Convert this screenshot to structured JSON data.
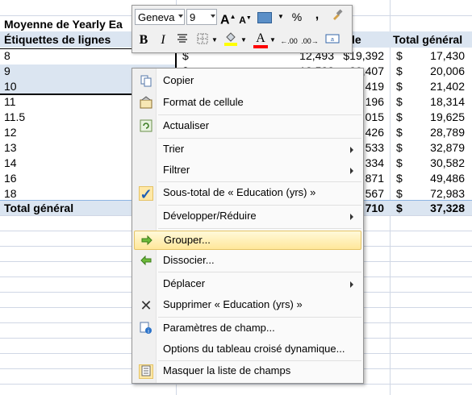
{
  "sheet": {
    "header_title": "Moyenne de Yearly Ea",
    "row_labels_header": "Étiquettes de lignes",
    "col_header_partial": "le",
    "total_header": "Total général",
    "rows": [
      {
        "label": "8",
        "mid": "12,493",
        "mid2": "$19,392",
        "total": "17,430"
      },
      {
        "label": "9",
        "mid": "18,533",
        "mid2": "20,407",
        "total": "20,006"
      },
      {
        "label": "10",
        "mid": "",
        "mid2": "419",
        "total": "21,402"
      },
      {
        "label": "11",
        "mid": "",
        "mid2": "196",
        "total": "18,314"
      },
      {
        "label": "11.5",
        "mid": "",
        "mid2": "015",
        "total": "19,625"
      },
      {
        "label": "12",
        "mid": "",
        "mid2": "426",
        "total": "28,789"
      },
      {
        "label": "13",
        "mid": "",
        "mid2": "533",
        "total": "32,879"
      },
      {
        "label": "14",
        "mid": "",
        "mid2": "334",
        "total": "30,582"
      },
      {
        "label": "16",
        "mid": "",
        "mid2": "871",
        "total": "49,486"
      },
      {
        "label": "18",
        "mid": "",
        "mid2": "567",
        "total": "72,983"
      }
    ],
    "grand_total_label": "Total général",
    "grand_total_mid": "710",
    "grand_total": "37,328",
    "currency": "$"
  },
  "mini_toolbar": {
    "font": "Geneva",
    "size": "9",
    "grow_font": "A",
    "shrink_font": "A",
    "percent": "%",
    "comma": ",",
    "bold": "B",
    "italic": "I",
    "font_color_letter": "A",
    "inc_decimal": "←.00",
    "dec_decimal": ".00→"
  },
  "menu": {
    "items": [
      {
        "label": "Copier"
      },
      {
        "label": "Format de cellule"
      },
      {
        "label": "Actualiser"
      },
      {
        "label": "Trier"
      },
      {
        "label": "Filtrer"
      },
      {
        "label": "Sous-total de « Education (yrs) »"
      },
      {
        "label": "Développer/Réduire"
      },
      {
        "label": "Grouper..."
      },
      {
        "label": "Dissocier..."
      },
      {
        "label": "Déplacer"
      },
      {
        "label": "Supprimer « Education (yrs) »"
      },
      {
        "label": "Paramètres de champ..."
      },
      {
        "label": "Options du tableau croisé dynamique..."
      },
      {
        "label": "Masquer la liste de champs"
      }
    ]
  },
  "colors": {
    "highlight": "#ffe79a",
    "row_band": "#dbe5f1",
    "grid": "#d0d7e5"
  }
}
